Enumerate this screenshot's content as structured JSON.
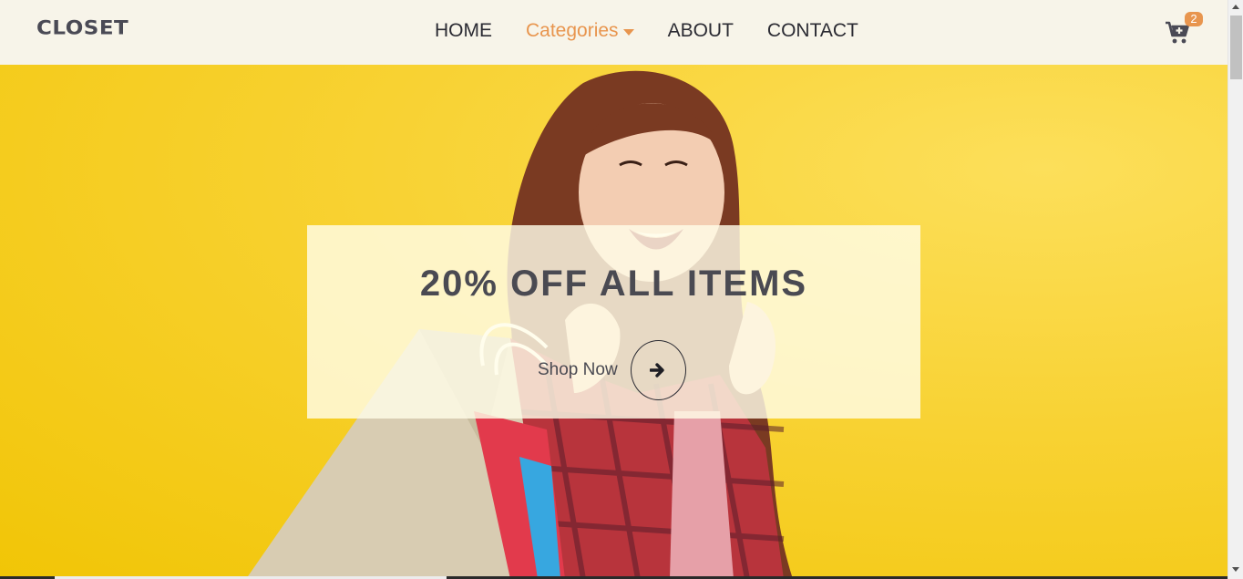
{
  "header": {
    "logo": "CLOSET",
    "nav": [
      {
        "label": "HOME"
      },
      {
        "label": "Categories"
      },
      {
        "label": "ABOUT"
      },
      {
        "label": "CONTACT"
      }
    ],
    "cart_count": "2",
    "cart_icon": "cart-plus-icon"
  },
  "hero": {
    "promo_title": "20% OFF ALL ITEMS",
    "cta_label": "Shop Now",
    "cta_icon": "arrow-right-icon"
  },
  "colors": {
    "accent": "#e8954e",
    "header_bg": "#f7f4e9",
    "hero_bg": "#f6d235",
    "text_dark": "#4a4a52"
  }
}
